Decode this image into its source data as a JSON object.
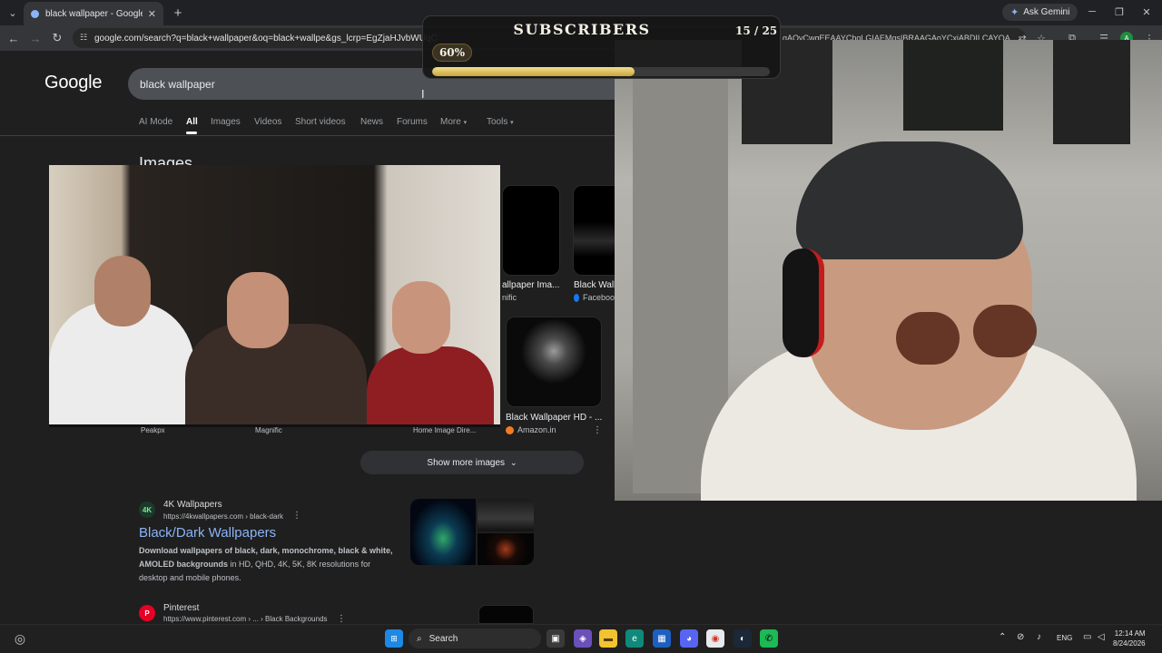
{
  "browser": {
    "tab_title": "black wallpaper - Google Search",
    "new_tab": "+",
    "ask_gemini": "Ask Gemini",
    "url": "google.com/search?q=black+wallpaper&oq=black+wallpe&gs_lcrp=EgZjaHJvbWUqC",
    "url_tail": "qAQyCwqEEAAYChqLGIAEMqsIBRAAGAoYCxiABDILCAYQA..."
  },
  "google": {
    "logo": "Google",
    "query": "black wallpaper",
    "tabs": [
      {
        "label": "AI Mode"
      },
      {
        "label": "All"
      },
      {
        "label": "Images"
      },
      {
        "label": "Videos"
      },
      {
        "label": "Short videos"
      },
      {
        "label": "News"
      },
      {
        "label": "Forums"
      },
      {
        "label": "More"
      },
      {
        "label": "Tools"
      }
    ],
    "images_heading": "Images",
    "image_results": [
      {
        "caption": "allpaper Ima...",
        "source": "nific",
        "src_color": "#9aa0a6"
      },
      {
        "caption": "Black Wallp",
        "source": "Faceboo",
        "src_color": "#1877f2"
      },
      {
        "caption": "Black Wallpaper HD - ...",
        "source": "Amazon.in",
        "src_color": "#f47b20"
      }
    ],
    "bottom_sources": [
      {
        "label": "Peakpx"
      },
      {
        "label": "Magnific"
      },
      {
        "label": "Home Image Dire..."
      }
    ],
    "show_more": "Show more images",
    "results": [
      {
        "icon": "4K",
        "site": "4K Wallpapers",
        "url": "https://4kwallpapers.com › black-dark",
        "title": "Black/Dark Wallpapers",
        "snippet_bold": "Download wallpapers of black, dark, monochrome, black & white, AMOLED backgrounds",
        "snippet_rest": " in HD, QHD, 4K, 5K, 8K resolutions for desktop and mobile phones."
      },
      {
        "icon": "P",
        "site": "Pinterest",
        "url": "https://www.pinterest.com › ... › Black Backgrounds"
      }
    ]
  },
  "overlay": {
    "title": "SUBSCRIBERS",
    "count": "15 / 25",
    "percent_label": "60%",
    "progress": 0.6
  },
  "taskbar": {
    "search": "Search",
    "lang": "ENG",
    "time": "12:14 AM",
    "date": "8/24/2026"
  },
  "colors": {
    "accent": "#8ab4f8",
    "gold": "#c9a53c",
    "background": "#1f1f1f"
  }
}
